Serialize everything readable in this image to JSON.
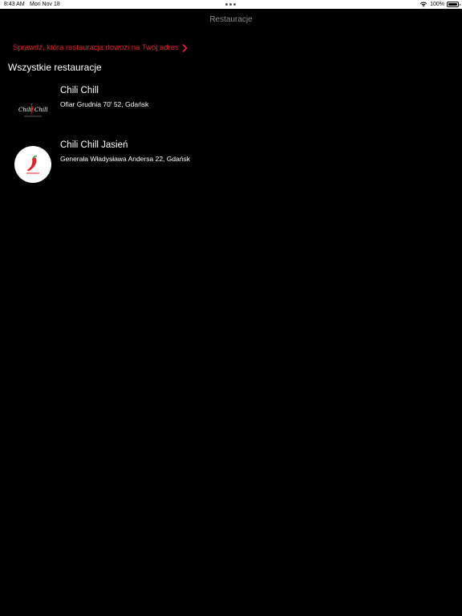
{
  "status_bar": {
    "time": "8:43 AM",
    "date": "Mon Nov 18",
    "battery": "100%",
    "battery_level": 1.0,
    "icons": [
      "multitasking-dots-icon",
      "wifi-icon",
      "battery-icon"
    ]
  },
  "nav": {
    "title": "Restauracje"
  },
  "check_link": {
    "label": "Sprawdź, która restauracja dowozi na Twój adres",
    "icon": "chevron-right-icon",
    "color": "#e8202a"
  },
  "section": {
    "title": "Wszystkie restauracje"
  },
  "restaurants": [
    {
      "name": "Chili Chill",
      "address": "Ofiar Grudnia 70' 52, Gdańsk",
      "logo": "chili-chill-logo-dark"
    },
    {
      "name": "Chili Chill Jasień",
      "address": "Generała Władysława Andersa 22, Gdańsk",
      "logo": "chili-pepper-logo-light"
    }
  ],
  "colors": {
    "background": "#000000",
    "accent": "#e8202a",
    "nav_title": "#8e8e93"
  }
}
